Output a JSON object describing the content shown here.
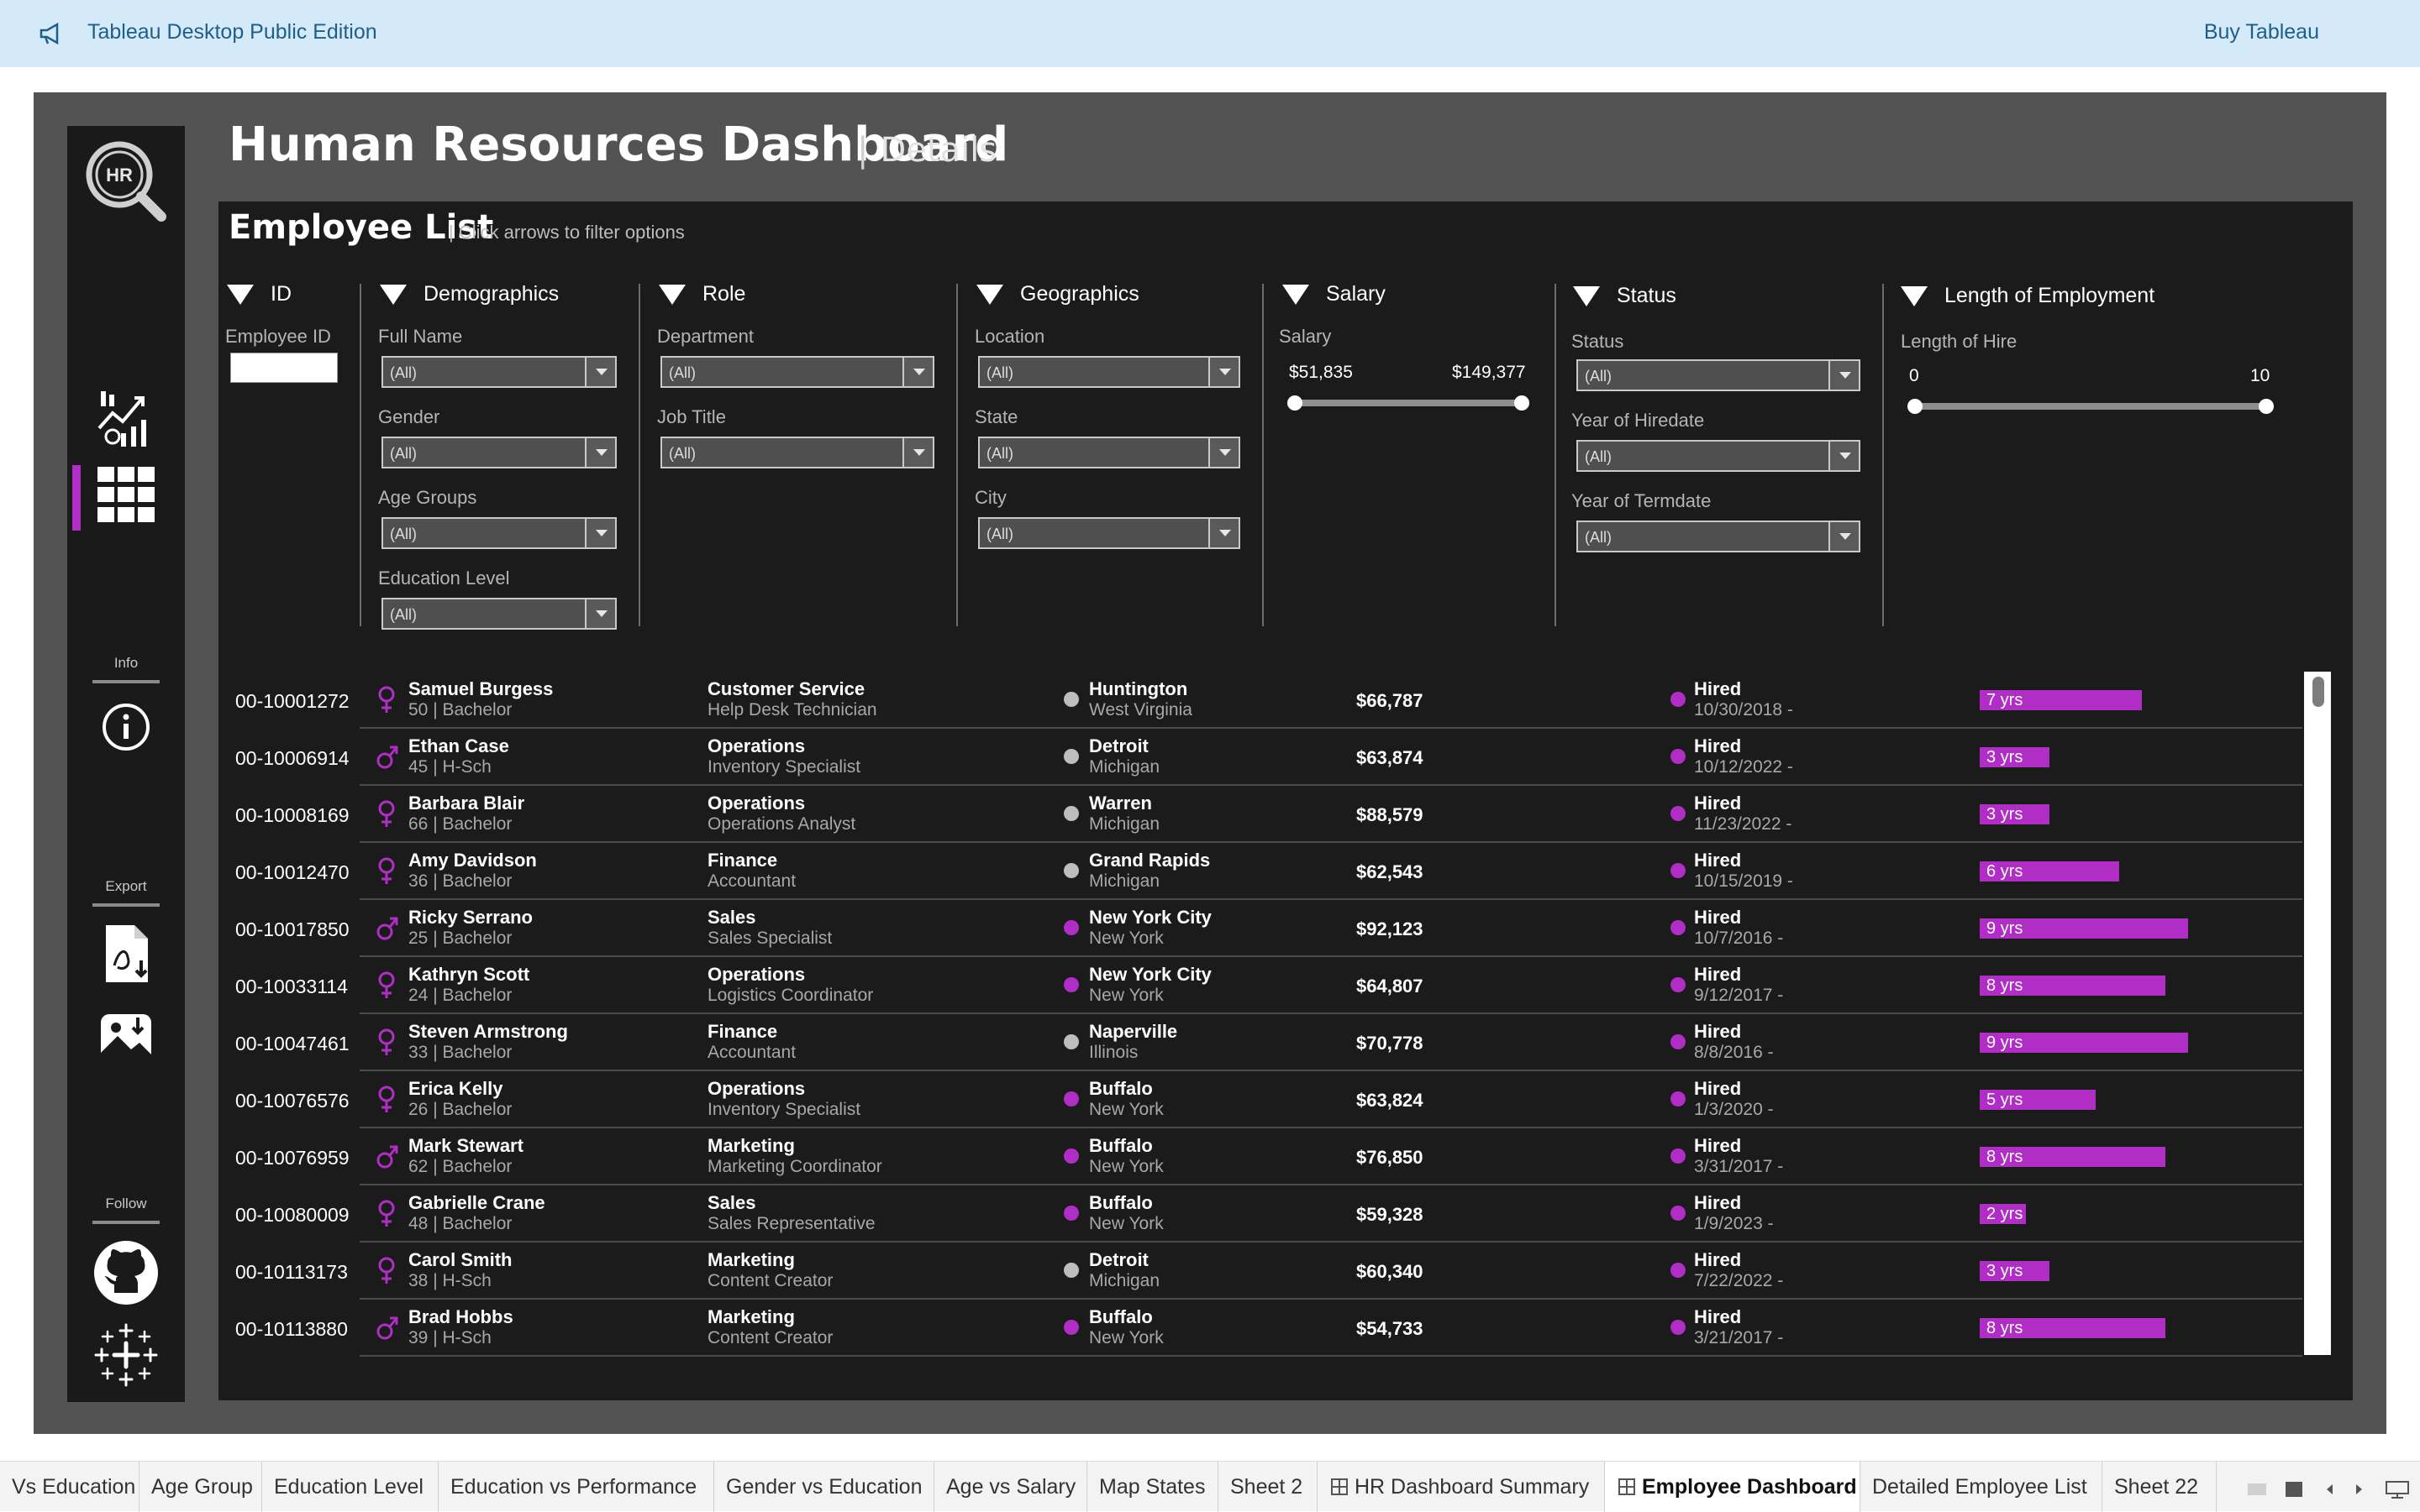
{
  "topbar": {
    "title": "Tableau Desktop Public Edition",
    "buy": "Buy Tableau",
    "icon": "megaphone-icon"
  },
  "header": {
    "title": "Human Resources Dashboard",
    "separator": "|",
    "subtitle": "Details"
  },
  "sidebar": {
    "logo": "HR",
    "info_label": "Info",
    "export_label": "Export",
    "follow_label": "Follow",
    "accent": "#b02ec6"
  },
  "employee_list": {
    "title": "Employee List",
    "hint": "| Click arrows to filter options"
  },
  "filters": {
    "id": {
      "header": "ID",
      "label": "Employee ID"
    },
    "demographics": {
      "header": "Demographics",
      "full_name": "Full Name",
      "gender": "Gender",
      "age_groups": "Age Groups",
      "education": "Education Level"
    },
    "role": {
      "header": "Role",
      "department": "Department",
      "job_title": "Job Title"
    },
    "geo": {
      "header": "Geographics",
      "location": "Location",
      "state": "State",
      "city": "City"
    },
    "salary": {
      "header": "Salary",
      "label": "Salary",
      "min": "$51,835",
      "max": "$149,377"
    },
    "status": {
      "header": "Status",
      "status": "Status",
      "year_hire": "Year of Hiredate",
      "year_term": "Year of Termdate"
    },
    "length": {
      "header": "Length of Employment",
      "label": "Length of Hire",
      "min": "0",
      "max": "10"
    },
    "all": "(All)"
  },
  "rows": [
    {
      "id": "00-10001272",
      "gender": "female",
      "name": "Samuel Burgess",
      "sub": "50 | Bachelor",
      "dept": "Customer Service",
      "job": "Help Desk Technician",
      "loc": "gray",
      "city": "Huntington",
      "state": "West Virginia",
      "salary": "$66,787",
      "status": "Hired",
      "date": "10/30/2018 -",
      "years": 7,
      "yrs": "7 yrs"
    },
    {
      "id": "00-10006914",
      "gender": "male",
      "name": "Ethan Case",
      "sub": "45 | H-Sch",
      "dept": "Operations",
      "job": "Inventory Specialist",
      "loc": "gray",
      "city": "Detroit",
      "state": "Michigan",
      "salary": "$63,874",
      "status": "Hired",
      "date": "10/12/2022 -",
      "years": 3,
      "yrs": "3 yrs"
    },
    {
      "id": "00-10008169",
      "gender": "female",
      "name": "Barbara Blair",
      "sub": "66 | Bachelor",
      "dept": "Operations",
      "job": "Operations Analyst",
      "loc": "gray",
      "city": "Warren",
      "state": "Michigan",
      "salary": "$88,579",
      "status": "Hired",
      "date": "11/23/2022 -",
      "years": 3,
      "yrs": "3 yrs"
    },
    {
      "id": "00-10012470",
      "gender": "female",
      "name": "Amy Davidson",
      "sub": "36 | Bachelor",
      "dept": "Finance",
      "job": "Accountant",
      "loc": "gray",
      "city": "Grand Rapids",
      "state": "Michigan",
      "salary": "$62,543",
      "status": "Hired",
      "date": "10/15/2019 -",
      "years": 6,
      "yrs": "6 yrs"
    },
    {
      "id": "00-10017850",
      "gender": "male",
      "name": "Ricky Serrano",
      "sub": "25 | Bachelor",
      "dept": "Sales",
      "job": "Sales Specialist",
      "loc": "purple",
      "city": "New York City",
      "state": "New York",
      "salary": "$92,123",
      "status": "Hired",
      "date": "10/7/2016 -",
      "years": 9,
      "yrs": "9 yrs"
    },
    {
      "id": "00-10033114",
      "gender": "female",
      "name": "Kathryn Scott",
      "sub": "24 | Bachelor",
      "dept": "Operations",
      "job": "Logistics Coordinator",
      "loc": "purple",
      "city": "New York City",
      "state": "New York",
      "salary": "$64,807",
      "status": "Hired",
      "date": "9/12/2017 -",
      "years": 8,
      "yrs": "8 yrs"
    },
    {
      "id": "00-10047461",
      "gender": "female",
      "name": "Steven Armstrong",
      "sub": "33 | Bachelor",
      "dept": "Finance",
      "job": "Accountant",
      "loc": "gray",
      "city": "Naperville",
      "state": "Illinois",
      "salary": "$70,778",
      "status": "Hired",
      "date": "8/8/2016 -",
      "years": 9,
      "yrs": "9 yrs"
    },
    {
      "id": "00-10076576",
      "gender": "female",
      "name": "Erica Kelly",
      "sub": "26 | Bachelor",
      "dept": "Operations",
      "job": "Inventory Specialist",
      "loc": "purple",
      "city": "Buffalo",
      "state": "New York",
      "salary": "$63,824",
      "status": "Hired",
      "date": "1/3/2020 -",
      "years": 5,
      "yrs": "5 yrs"
    },
    {
      "id": "00-10076959",
      "gender": "male",
      "name": "Mark Stewart",
      "sub": "62 | Bachelor",
      "dept": "Marketing",
      "job": "Marketing Coordinator",
      "loc": "purple",
      "city": "Buffalo",
      "state": "New York",
      "salary": "$76,850",
      "status": "Hired",
      "date": "3/31/2017 -",
      "years": 8,
      "yrs": "8 yrs"
    },
    {
      "id": "00-10080009",
      "gender": "female",
      "name": "Gabrielle Crane",
      "sub": "48 | Bachelor",
      "dept": "Sales",
      "job": "Sales Representative",
      "loc": "purple",
      "city": "Buffalo",
      "state": "New York",
      "salary": "$59,328",
      "status": "Hired",
      "date": "1/9/2023 -",
      "years": 2,
      "yrs": "2 yrs"
    },
    {
      "id": "00-10113173",
      "gender": "female",
      "name": "Carol Smith",
      "sub": "38 | H-Sch",
      "dept": "Marketing",
      "job": "Content Creator",
      "loc": "gray",
      "city": "Detroit",
      "state": "Michigan",
      "salary": "$60,340",
      "status": "Hired",
      "date": "7/22/2022 -",
      "years": 3,
      "yrs": "3 yrs"
    },
    {
      "id": "00-10113880",
      "gender": "male",
      "name": "Brad Hobbs",
      "sub": "39 | H-Sch",
      "dept": "Marketing",
      "job": "Content Creator",
      "loc": "purple",
      "city": "Buffalo",
      "state": "New York",
      "salary": "$54,733",
      "status": "Hired",
      "date": "3/21/2017 -",
      "years": 8,
      "yrs": "8 yrs"
    }
  ],
  "colors": {
    "purple": "#b02ec6",
    "gray": "#bdbdbd",
    "female_icon": "#b02ec6",
    "male_icon": "#b02ec6"
  },
  "tabs": [
    {
      "label": "Vs Education"
    },
    {
      "label": "Age Group"
    },
    {
      "label": "Education Level"
    },
    {
      "label": "Education vs Performance"
    },
    {
      "label": "Gender vs Education"
    },
    {
      "label": "Age vs Salary"
    },
    {
      "label": "Map States"
    },
    {
      "label": "Sheet 2"
    },
    {
      "label": "HR Dashboard Summary",
      "icon": "dashboard-grid-icon"
    },
    {
      "label": "Employee Dashboard",
      "icon": "dashboard-grid-icon",
      "active": true
    },
    {
      "label": "Detailed Employee List"
    },
    {
      "label": "Sheet 22"
    }
  ]
}
